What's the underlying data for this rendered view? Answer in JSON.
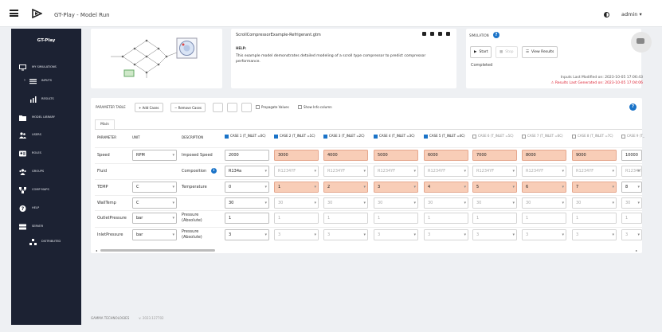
{
  "header": {
    "title": "GT-Play - Model Run",
    "user": "admin"
  },
  "sidebar": {
    "brand": "GT-Play",
    "items": [
      {
        "label": "MY SIMULATIONS",
        "icon": "monitor-icon"
      },
      {
        "label": "INPUTS",
        "icon": "list-icon"
      },
      {
        "label": "RESULTS",
        "icon": "bar-chart-icon"
      },
      {
        "label": "MODEL LIBRARY",
        "icon": "folder-icon"
      },
      {
        "label": "USERS",
        "icon": "users-icon"
      },
      {
        "label": "ROLES",
        "icon": "id-card-icon"
      },
      {
        "label": "GROUPS",
        "icon": "group-icon"
      },
      {
        "label": "COMP MAPS",
        "icon": "network-icon"
      },
      {
        "label": "HELP",
        "icon": "help-icon"
      },
      {
        "label": "SERVER",
        "icon": "server-icon"
      },
      {
        "label": "DISTRIBUTED",
        "icon": "distributed-icon"
      }
    ]
  },
  "footer": {
    "company": "GAMMA TECHNOLOGIES",
    "version": "v. 2023.127702"
  },
  "model": {
    "file_name": "ScrollCompressorExample-Refrigerant.gtm",
    "help_heading": "HELP:",
    "help_text": "This example model demonstrates detailed modeling of a scroll type compressor to predict compressor performance."
  },
  "simulation": {
    "title": "SIMULATION",
    "start_label": "Start",
    "stop_label": "Stop",
    "view_results_label": "View Results",
    "status": "Completed",
    "inputs_modified": "Inputs Last Modified on: 2023-10-05 17:06:43",
    "results_generated": "Results Last Generated on: 2023-10-05 17:04:06"
  },
  "param_table": {
    "label": "PARAMETER TABLE",
    "add_cases": "Add Cases",
    "remove_cases": "Remove Cases",
    "propagate_values": "Propagate Values",
    "show_info": "Show Info column",
    "tab": "Main",
    "headers": {
      "parameter": "PARAMETER",
      "unit": "UNIT",
      "description": "DESCRIPTION"
    },
    "cases": [
      {
        "label": "CASE 1 (T_INLET =0C)",
        "checked": true
      },
      {
        "label": "CASE 2 (T_INLET =1C)",
        "checked": true
      },
      {
        "label": "CASE 3 (T_INLET =2C)",
        "checked": true
      },
      {
        "label": "CASE 4 (T_INLET =3C)",
        "checked": true
      },
      {
        "label": "CASE 5 (T_INLET =4C)",
        "checked": true
      },
      {
        "label": "CASE 6 (T_INLET =5C)",
        "checked": false
      },
      {
        "label": "CASE 7 (T_INLET =6C)",
        "checked": false
      },
      {
        "label": "CASE 8 (T_INLET =7C)",
        "checked": false
      },
      {
        "label": "CASE 9 (T_",
        "checked": false
      }
    ],
    "rows": [
      {
        "parameter": "Speed",
        "unit": "RPM",
        "description": "Imposed Speed",
        "values": [
          "2000",
          "3000",
          "4000",
          "5000",
          "6000",
          "7000",
          "8000",
          "9000",
          "10000"
        ],
        "select": false
      },
      {
        "parameter": "Fluid",
        "unit": "",
        "description": "Composition",
        "values": [
          "R134a",
          "R1234YF",
          "R1234YF",
          "R1234YF",
          "R1234YF",
          "R1234YF",
          "R1234YF",
          "R1234YF",
          "R1234YF"
        ],
        "select": true
      },
      {
        "parameter": "TEMP",
        "unit": "C",
        "description": "Temperature",
        "values": [
          "0",
          "1",
          "2",
          "3",
          "4",
          "5",
          "6",
          "7",
          "8"
        ],
        "select": true
      },
      {
        "parameter": "WallTemp",
        "unit": "C",
        "description": "",
        "values": [
          "30",
          "30",
          "30",
          "30",
          "30",
          "30",
          "30",
          "30",
          "30"
        ],
        "select": true
      },
      {
        "parameter": "OutletPressure",
        "unit": "bar",
        "description": "Pressure (Absolute)",
        "values": [
          "1",
          "1",
          "1",
          "1",
          "1",
          "1",
          "1",
          "1",
          "1"
        ],
        "select": false
      },
      {
        "parameter": "InletPressure",
        "unit": "bar",
        "description": "Pressure (Absolute)",
        "values": [
          "3",
          "3",
          "3",
          "3",
          "3",
          "3",
          "3",
          "3",
          "3"
        ],
        "select": true
      }
    ]
  },
  "colors": {
    "sidebar": "#1c2233",
    "accent": "#1a73c8",
    "highlight": "#f8cdb7",
    "warning": "#dd2233"
  }
}
